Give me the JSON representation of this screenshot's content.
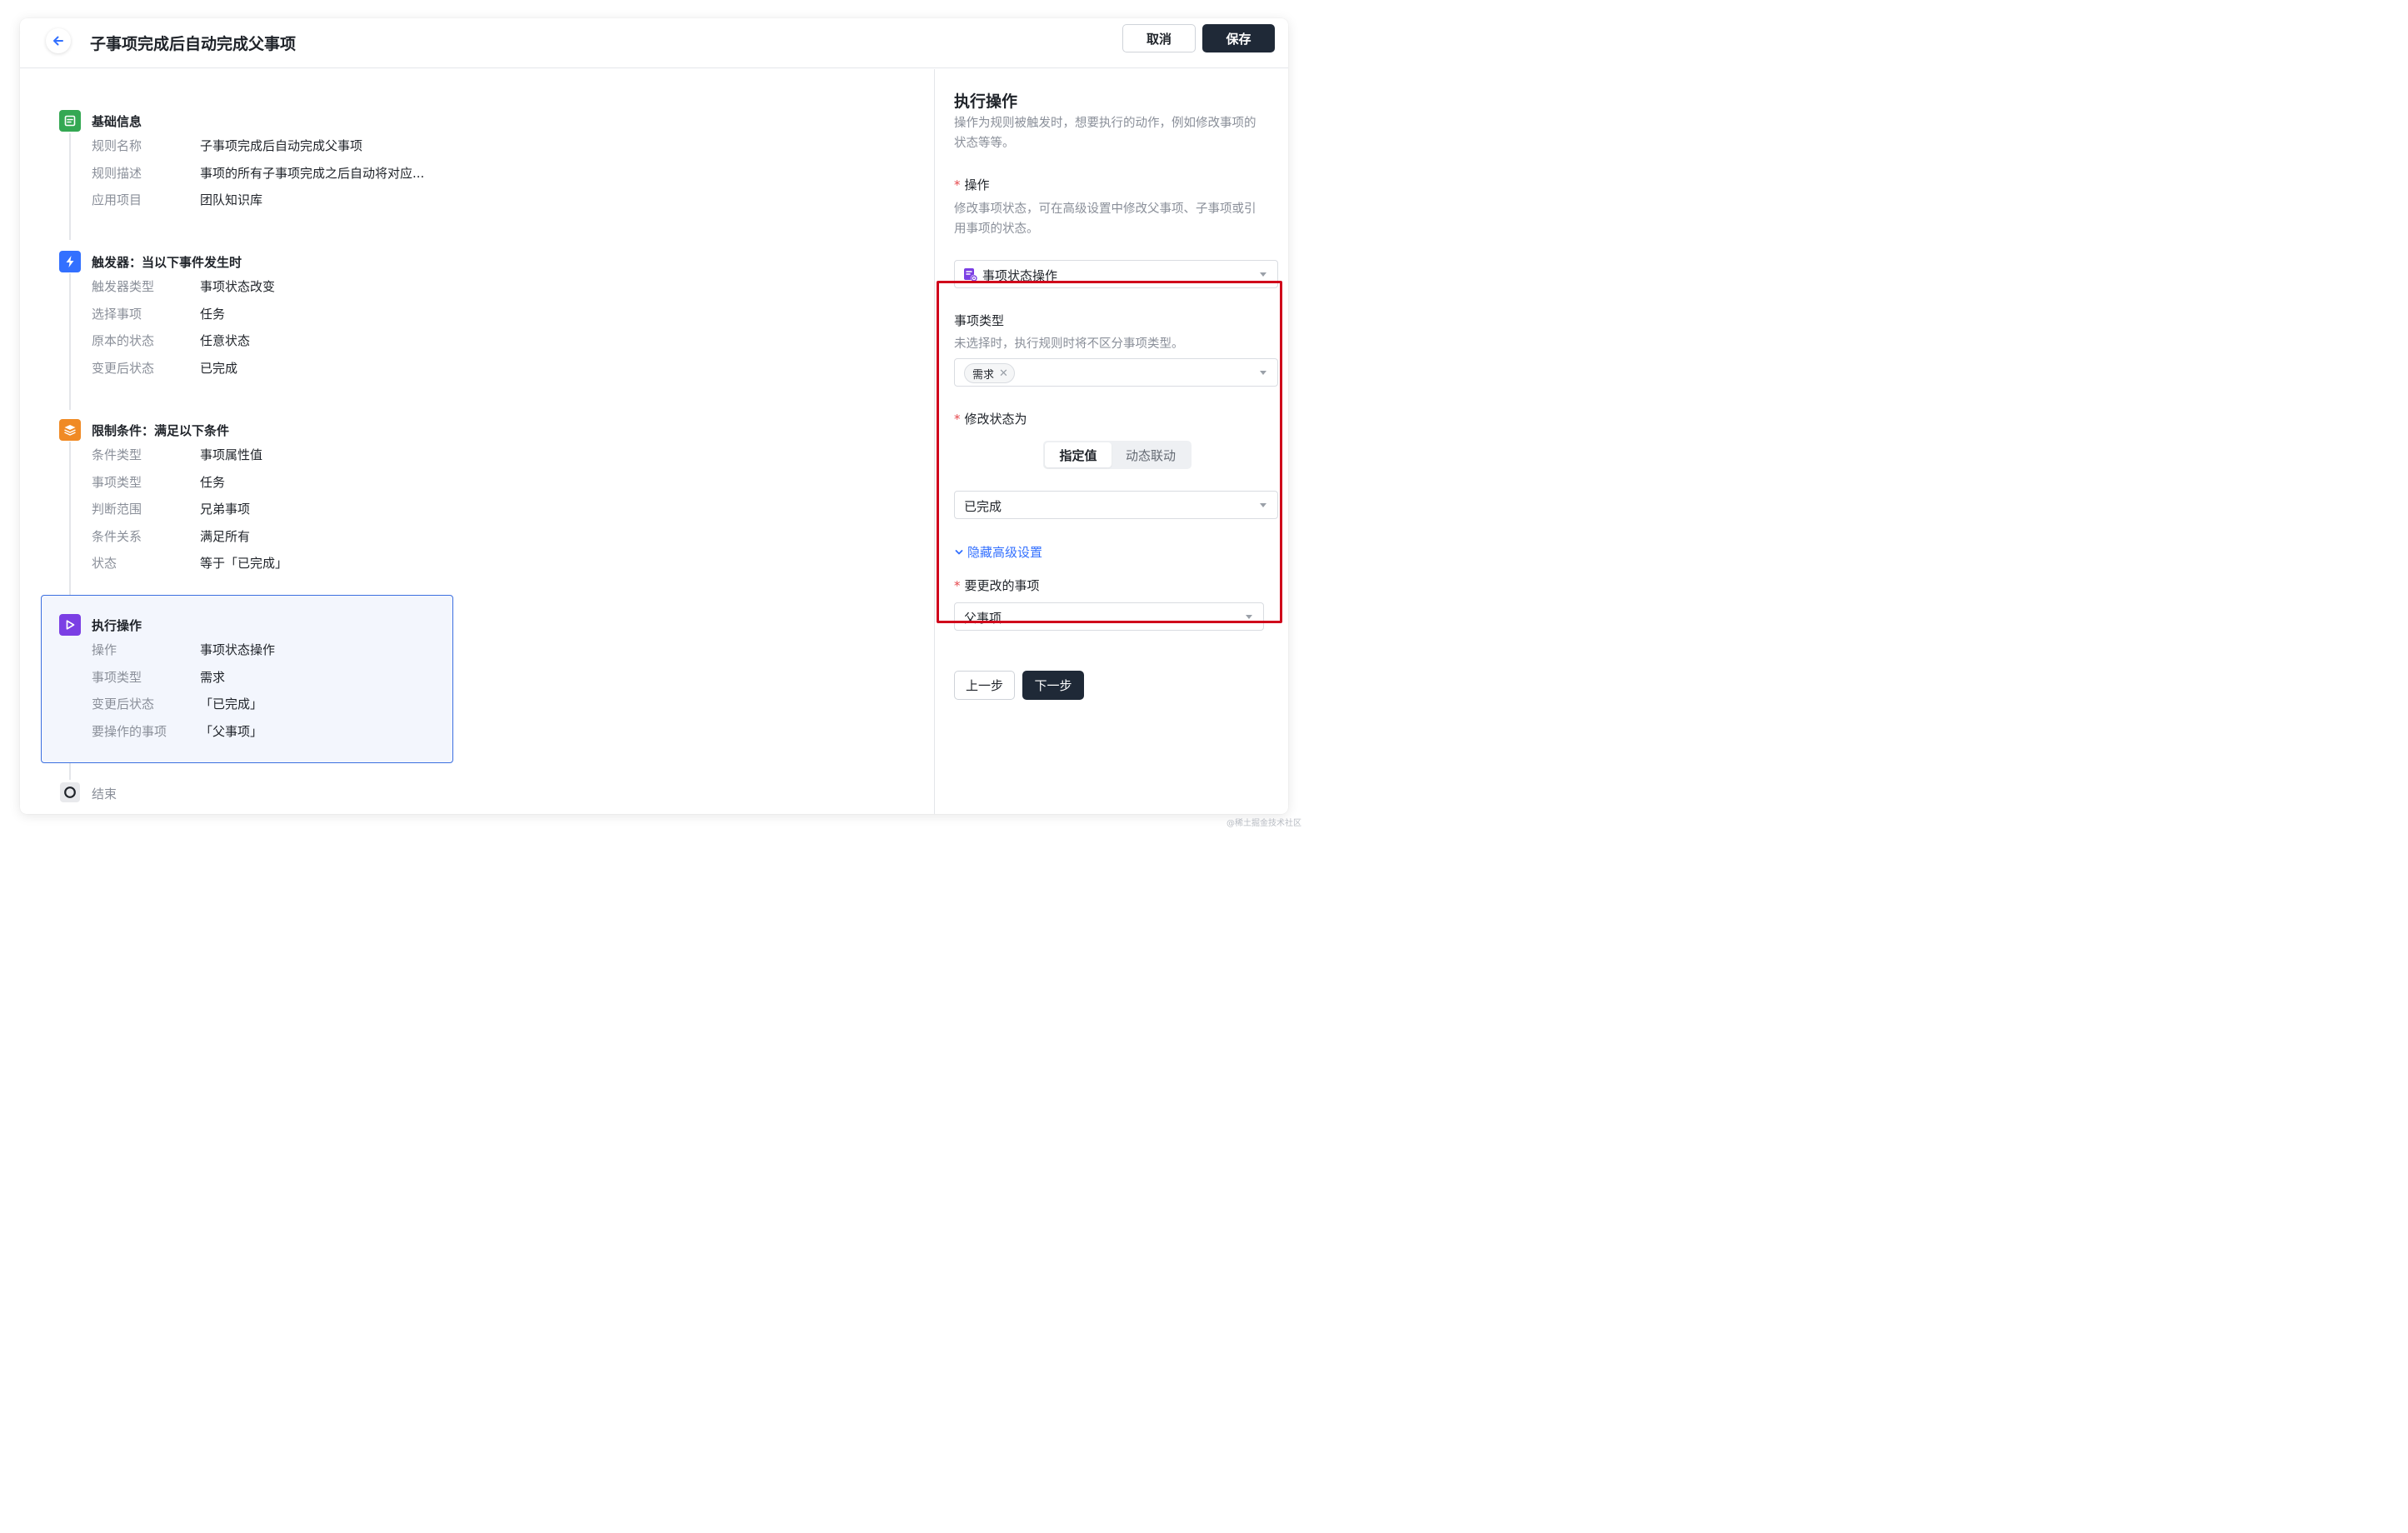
{
  "header": {
    "title": "子事项完成后自动完成父事项",
    "cancel_label": "取消",
    "save_label": "保存",
    "back_icon": "arrow-left-icon"
  },
  "flow": {
    "basic": {
      "title": "基础信息",
      "icon": "document-icon",
      "color": "#34a853",
      "rows": [
        {
          "label": "规则名称",
          "value": "子事项完成后自动完成父事项"
        },
        {
          "label": "规则描述",
          "value": "事项的所有子事项完成之后自动将对应..."
        },
        {
          "label": "应用项目",
          "value": "团队知识库"
        }
      ]
    },
    "trigger": {
      "title": "触发器：当以下事件发生时",
      "icon": "lightning-icon",
      "color": "#3370ff",
      "rows": [
        {
          "label": "触发器类型",
          "value": "事项状态改变"
        },
        {
          "label": "选择事项",
          "value": "任务"
        },
        {
          "label": "原本的状态",
          "value": "任意状态"
        },
        {
          "label": "变更后状态",
          "value": "已完成"
        }
      ]
    },
    "condition": {
      "title": "限制条件：满足以下条件",
      "icon": "layers-icon",
      "color": "#f08a24",
      "rows": [
        {
          "label": "条件类型",
          "value": "事项属性值"
        },
        {
          "label": "事项类型",
          "value": "任务"
        },
        {
          "label": "判断范围",
          "value": "兄弟事项"
        },
        {
          "label": "条件关系",
          "value": "满足所有"
        },
        {
          "label": "状态",
          "value": "等于「已完成」"
        }
      ]
    },
    "action": {
      "title": "执行操作",
      "icon": "play-icon",
      "color": "#7b3fe4",
      "rows": [
        {
          "label": "操作",
          "value": "事项状态操作"
        },
        {
          "label": "事项类型",
          "value": "需求"
        },
        {
          "label": "变更后状态",
          "value": "「已完成」"
        },
        {
          "label": "要操作的事项",
          "value": "「父事项」"
        }
      ]
    },
    "end": {
      "label": "结束",
      "icon": "circle-icon"
    }
  },
  "panel": {
    "title": "执行操作",
    "desc_line1": "操作为规则被触发时，想要执行的动作，例如修改事项的",
    "desc_line2": "状态等等。",
    "operation": {
      "label": "操作",
      "help_line1": "修改事项状态，可在高级设置中修改父事项、子事项或引",
      "help_line2": "用事项的状态。",
      "value": "事项状态操作",
      "icon": "status-operation-icon"
    },
    "item_type": {
      "label": "事项类型",
      "help": "未选择时，执行规则时将不区分事项类型。",
      "tag": "需求"
    },
    "modify_status": {
      "label": "修改状态为",
      "seg_active": "指定值",
      "seg_other": "动态联动",
      "value": "已完成"
    },
    "toggle_advanced": "隐藏高级设置",
    "target_item": {
      "label": "要更改的事项",
      "value": "父事项"
    },
    "prev_label": "上一步",
    "next_label": "下一步"
  },
  "colors": {
    "primary_dark": "#1f2937",
    "link": "#3370ff",
    "highlight": "#d0021b",
    "active_border": "#3b6fe0"
  },
  "watermark": "@稀土掘金技术社区"
}
